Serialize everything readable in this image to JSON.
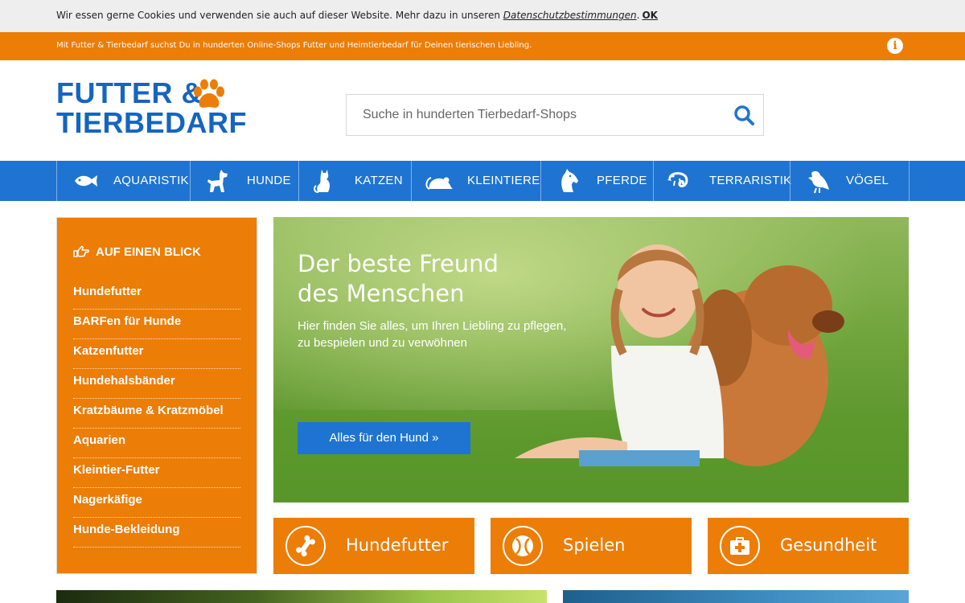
{
  "cookie_bar": {
    "text": "Wir essen gerne Cookies und verwenden sie auch auf dieser Website. Mehr dazu in unseren ",
    "link": "Datenschutzbestimmungen",
    "separator": ".",
    "ok": "OK"
  },
  "info_bar": {
    "text": "Mit Futter & Tierbedarf suchst Du in hunderten Online-Shops Futter und Heimtierbedarf für Deinen tierischen Liebling.",
    "icon": "info-icon",
    "icon_glyph": "i"
  },
  "logo": {
    "line1": "FUTTER &",
    "line2": "TIERBEDARF",
    "icon": "paw-icon"
  },
  "search": {
    "placeholder": "Suche in hunderten Tierbedarf-Shops",
    "value": "",
    "icon": "search-icon"
  },
  "nav": {
    "items": [
      {
        "label": "AQUARISTIK",
        "icon": "fish-icon"
      },
      {
        "label": "HUNDE",
        "icon": "dog-icon"
      },
      {
        "label": "KATZEN",
        "icon": "cat-icon"
      },
      {
        "label": "KLEINTIERE",
        "icon": "mouse-icon"
      },
      {
        "label": "PFERDE",
        "icon": "horse-icon"
      },
      {
        "label": "TERRARISTIK",
        "icon": "chameleon-icon"
      },
      {
        "label": "VÖGEL",
        "icon": "bird-icon"
      }
    ]
  },
  "sidebar": {
    "title": "AUF EINEN BLICK",
    "title_icon": "pointing-hand-icon",
    "items": [
      {
        "label": "Hundefutter"
      },
      {
        "label": "BARFen für Hunde"
      },
      {
        "label": "Katzenfutter"
      },
      {
        "label": "Hundehalsbänder"
      },
      {
        "label": "Kratzbäume & Kratzmöbel"
      },
      {
        "label": "Aquarien"
      },
      {
        "label": "Kleintier-Futter"
      },
      {
        "label": "Nagerkäfige"
      },
      {
        "label": "Hunde-Bekleidung"
      }
    ]
  },
  "hero": {
    "title_line1": "Der beste Freund",
    "title_line2": "des Menschen",
    "subtitle_line1": "Hier finden Sie alles, um Ihren Liebling zu pflegen,",
    "subtitle_line2": "zu bespielen und zu verwöhnen",
    "button": "Alles für den Hund »"
  },
  "tiles": [
    {
      "label": "Hundefutter",
      "icon": "bone-icon"
    },
    {
      "label": "Spielen",
      "icon": "ball-icon"
    },
    {
      "label": "Gesundheit",
      "icon": "first-aid-icon"
    }
  ],
  "colors": {
    "brand_orange": "#ec7d07",
    "brand_blue": "#1f74d1",
    "logo_blue": "#1565c0",
    "cookie_bg": "#eeeeee"
  }
}
